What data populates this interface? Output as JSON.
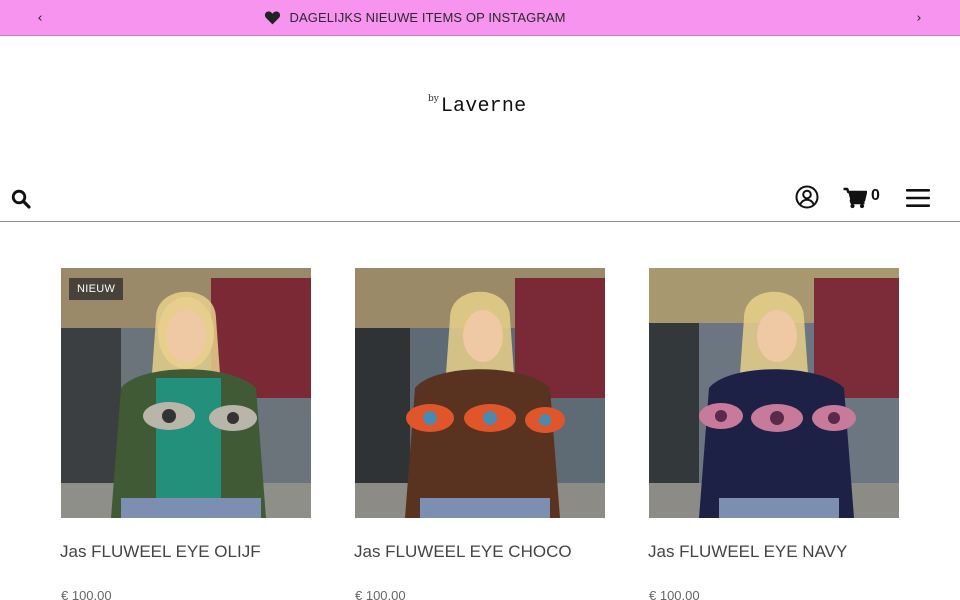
{
  "announcement": {
    "message": "DAGELIJKS NIEUWE ITEMS OP INSTAGRAM",
    "prev_icon": "chevron-left-icon",
    "next_icon": "chevron-right-icon",
    "icon": "heart-icon",
    "bg_color": "#f794ef"
  },
  "logo": {
    "prefix": "by",
    "name": "Laverne"
  },
  "header": {
    "search_icon": "search-icon",
    "account_icon": "user-circle-icon",
    "cart_icon": "shopping-cart-icon",
    "cart_count": "0",
    "menu_icon": "hamburger-menu-icon"
  },
  "products": [
    {
      "badge": "NIEUW",
      "title": "Jas FLUWEEL EYE OLIJF",
      "price": "€ 100,00",
      "jacket_color": "#3f5a34",
      "accent_color": "#1f9a8a"
    },
    {
      "badge": "",
      "title": "Jas FLUWEEL EYE CHOCO",
      "price": "€ 100,00",
      "jacket_color": "#5a3220",
      "accent_color": "#e0562a"
    },
    {
      "badge": "",
      "title": "Jas FLUWEEL EYE NAVY",
      "price": "€ 100,00",
      "jacket_color": "#1d2146",
      "accent_color": "#c77a9a"
    }
  ]
}
